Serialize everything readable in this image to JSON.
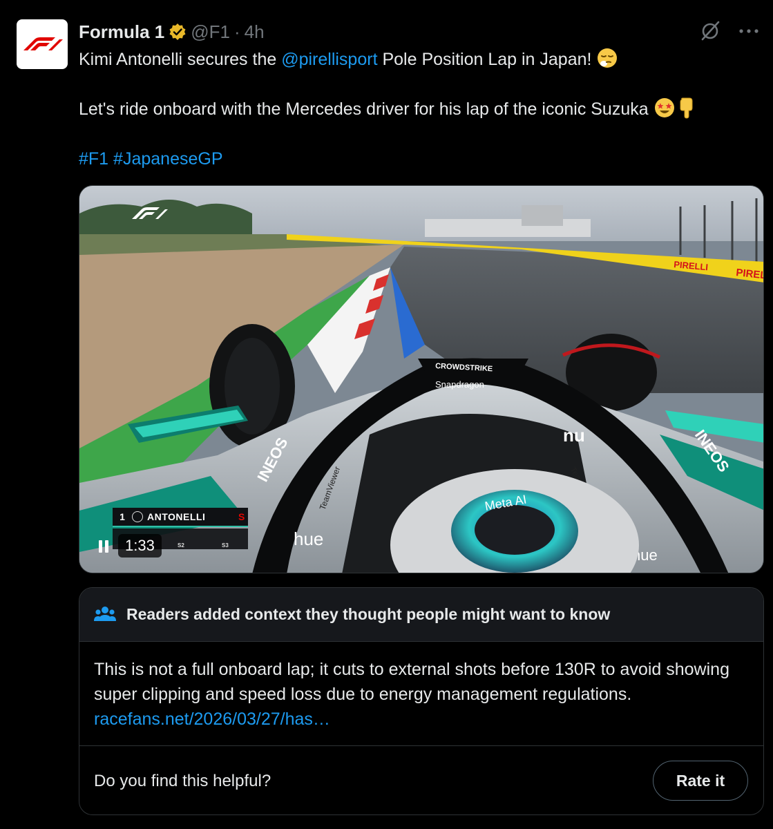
{
  "author": {
    "name": "Formula 1",
    "handle": "@F1",
    "separator": "·",
    "time": "4h",
    "verified": true
  },
  "icons": {
    "avatar": "f1-logo-icon",
    "verified": "gold-verified-badge-icon",
    "grok": "grok-icon",
    "more": "more-icon",
    "people": "people-icon"
  },
  "post": {
    "line1_prefix": "Kimi Antonelli secures the ",
    "line1_mention": "@pirellisport",
    "line1_suffix": " Pole Position Lap in Japan! ",
    "line1_emoji": "relieved-face-emoji",
    "line2_text": "Let's ride onboard with the Mercedes driver for his lap of the iconic Suzuka ",
    "line2_emojis": [
      "star-struck-emoji",
      "backhand-index-pointing-down-emoji"
    ],
    "hashtag1": "#F1",
    "hashtag2": "#JapaneseGP"
  },
  "video": {
    "time": "1:33",
    "state": "playing",
    "hud": {
      "position": "1",
      "driver": "ANTONELLI",
      "flag": "S",
      "sector2": "S2",
      "sector3": "S3"
    },
    "car_text": {
      "halo_sponsor": "CROWDSTRIKE",
      "nose_sponsor": "Snapdragon",
      "helmet_sponsor": "Meta AI",
      "sidepod_left": "INEOS",
      "sidepod_right": "INEOS",
      "mirror_text": "nu",
      "teamviewer": "TeamViewer",
      "hue": "hue",
      "barrier": "PIRELLI"
    }
  },
  "community_note": {
    "title": "Readers added context they thought people might want to know",
    "body": "This is not a full onboard lap; it cuts to external shots before 130R to avoid showing super clipping and speed loss due to energy management regulations. ",
    "link": "racefans.net/2026/03/27/has…",
    "helpful_question": "Do you find this helpful?",
    "rate_label": "Rate it"
  },
  "colors": {
    "background": "#000000",
    "text": "#e7e9ea",
    "secondary": "#71767b",
    "link": "#1d9bf0",
    "border": "#2f3336",
    "f1_red": "#e10600",
    "verified_gold": "#e8b829",
    "mercedes_teal": "#00d2be"
  }
}
